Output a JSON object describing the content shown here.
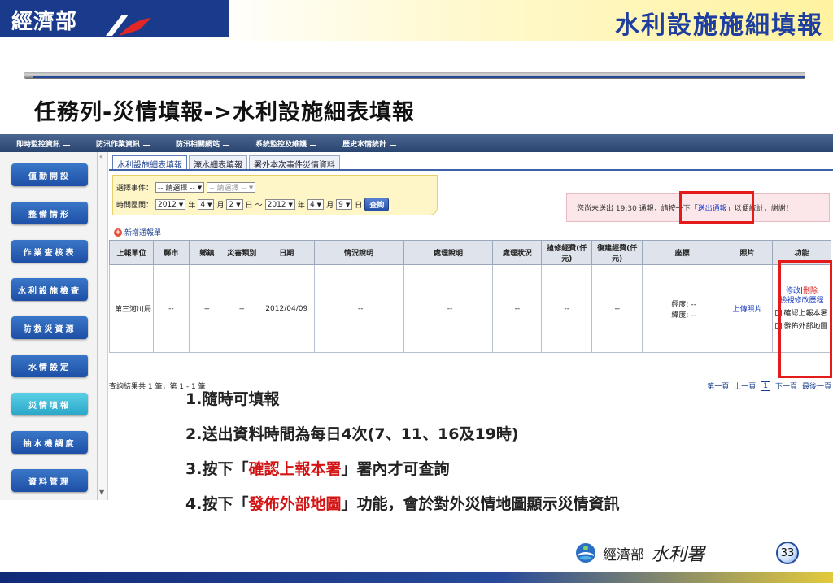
{
  "banner": {
    "logo": "經濟部",
    "slide_title": "水利設施施細填報"
  },
  "heading": "任務列-災情填報->水利設施細表填報",
  "menu": [
    {
      "label": "即時監控資訊"
    },
    {
      "label": "防汛作業資訊"
    },
    {
      "label": "防汛相關網站"
    },
    {
      "label": "系統監控及維護"
    },
    {
      "label": "歷史水情統計"
    }
  ],
  "sidebar": [
    {
      "label": "值勤開設",
      "active": false
    },
    {
      "label": "整備情形",
      "active": false
    },
    {
      "label": "作業查核表",
      "active": false
    },
    {
      "label": "水利設施檢查",
      "active": false
    },
    {
      "label": "防救災資源",
      "active": false
    },
    {
      "label": "水情設定",
      "active": false
    },
    {
      "label": "災情填報",
      "active": true
    },
    {
      "label": "抽水機調度",
      "active": false
    },
    {
      "label": "資料管理",
      "active": false
    }
  ],
  "tabs": [
    {
      "label": "水利設施細表填報",
      "active": true
    },
    {
      "label": "淹水細表填報",
      "active": false
    },
    {
      "label": "署外本次事件災情資料",
      "active": false
    }
  ],
  "filter": {
    "event_label": "選擇事件：",
    "event_select": "-- 請選擇 --",
    "event_select2": "-- 請選擇 --",
    "range_label": "時間區間：",
    "from_year": "2012",
    "year_unit": "年",
    "from_month": "4",
    "month_unit": "月",
    "from_day": "2",
    "day_unit": "日",
    "tilde": "～",
    "to_year": "2012",
    "to_month": "4",
    "to_day": "9",
    "query_button": "查詢"
  },
  "notice": {
    "prefix": "您尚未送出 19:30 通報，請按一下「",
    "link": "送出通報",
    "suffix": "」以便統計，謝謝！"
  },
  "add_link": "新增通報單",
  "table": {
    "headers": [
      "上報單位",
      "縣市",
      "鄉鎮",
      "災害類別",
      "日期",
      "情況說明",
      "處理說明",
      "處理狀況",
      "搶修經費(仟元)",
      "復建經費(仟元)",
      "座標",
      "照片",
      "功能"
    ],
    "row": {
      "unit": "第三河川局",
      "county": "--",
      "town": "--",
      "type": "--",
      "date": "2012/04/09",
      "situation": "--",
      "handling": "--",
      "status": "--",
      "repair_cost": "--",
      "rebuild_cost": "--",
      "coord_lng": "經度: --",
      "coord_lat": "緯度: --",
      "photo": "上傳照片",
      "func_edit": "修改",
      "func_sep": "|",
      "func_delete": "刪除",
      "func_history": "檢視修改歷程",
      "func_confirm": "確認上報本署",
      "func_publish": "發佈外部地圖"
    }
  },
  "result": {
    "summary": "查詢結果共 1 筆，第 1 - 1 筆",
    "first": "第一頁",
    "prev": "上一頁",
    "page": "1",
    "next": "下一頁",
    "last": "最後一頁"
  },
  "notes": {
    "n1": "1.隨時可填報",
    "n2": "2.送出資料時間為每日4次(7、11、16及19時)",
    "n3_pre": "3.按下「",
    "n3_hl": "確認上報本署",
    "n3_post": "」署內才可查詢",
    "n4_pre": "4.按下「",
    "n4_hl": "發佈外部地圖",
    "n4_post": "」功能，會於對外災情地圖顯示災情資訊"
  },
  "footer": {
    "org": "經濟部",
    "agency": "水利署",
    "page_number": "33"
  }
}
